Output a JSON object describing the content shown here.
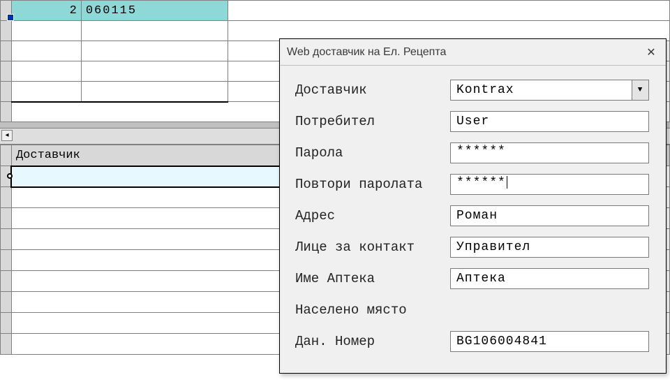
{
  "top_grid": {
    "selected_row_number": "2",
    "selected_cell_value": "060115"
  },
  "bottom_grid": {
    "header": "Доставчик"
  },
  "dialog": {
    "title": "Web доставчик на Ел. Рецепта",
    "labels": {
      "provider": "Доставчик",
      "user": "Потребител",
      "password": "Парола",
      "password_repeat": "Повтори паролата",
      "address": "Адрес",
      "contact_person": "Лице за контакт",
      "pharmacy_name": "Име Аптека",
      "settlement": "Населено място",
      "tax_number": "Дан. Номер"
    },
    "values": {
      "provider": "Kontrax",
      "user": "User",
      "password": "******",
      "password_repeat": "******",
      "address": "Роман",
      "contact_person": "Управител",
      "pharmacy_name": "Аптека",
      "settlement": "",
      "tax_number": "BG106004841"
    }
  }
}
